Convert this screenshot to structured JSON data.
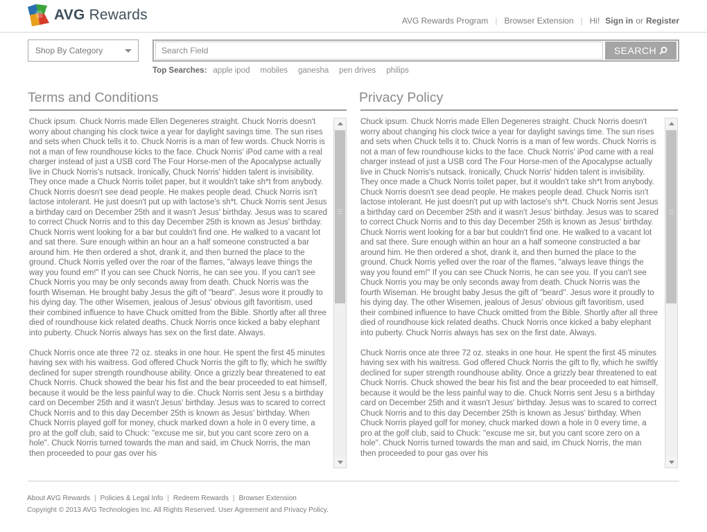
{
  "header": {
    "logo_brand": "AVG",
    "logo_product": "Rewards",
    "links": {
      "program": "AVG Rewards Program",
      "extension": "Browser Extension",
      "greeting": "Hi!",
      "sign_in": "Sign in",
      "or": "or",
      "register": "Register"
    }
  },
  "search": {
    "category_label": "Shop By Category",
    "placeholder": "Search Field",
    "button_label": "SEARCH",
    "top_searches_label": "Top Searches:",
    "top_searches": [
      "apple ipod",
      "mobiles",
      "ganesha",
      "pen drives",
      "philips"
    ]
  },
  "panels": [
    {
      "title": "Terms and Conditions",
      "paragraphs": [
        "Chuck ipsum. Chuck Norris made Ellen Degeneres straight. Chuck Norris doesn't worry about changing his clock twice a year for daylight savings time. The sun rises and sets when Chuck tells it to. Chuck Norris is a man of few words. Chuck Norris is not a man of few roundhouse kicks to the face. Chuck Norris' iPod came with a real charger instead of just a USB cord The Four Horse-men of the Apocalypse actually live in Chuck Norris's nutsack. Ironically, Chuck Norris' hidden talent is invisibility. They once made a Chuck Norris toilet paper, but it wouldn't take sh*t from anybody. Chuck Norris doesn't see dead people. He makes people dead. Chuck Norris isn't lactose intolerant. He just doesn't put up with lactose's sh*t. Chuck Norris sent Jesus a birthday card on December 25th and it wasn't Jesus' birthday. Jesus was to scared to correct Chuck Norris and to this day December 25th is known as Jesus' birthday. Chuck Norris went looking for a bar but couldn't find one. He walked to a vacant lot and sat there. Sure enough within an hour an a half someone constructed a bar around him. He then ordered a shot, drank it, and then burned the place to the ground. Chuck Norris yelled over the roar of the flames, \"always leave things the way you found em!\" If you can see Chuck Norris, he can see you. If you can't see Chuck Norris you may be only seconds away from death. Chuck Norris was the fourth Wiseman. He brought baby Jesus the gift of \"beard\". Jesus wore it proudly to his dying day. The other Wisemen, jealous of Jesus' obvious gift favoritism, used their combined influence to have Chuck omitted from the Bible. Shortly after all three died of roundhouse kick related deaths. Chuck Norris once kicked a baby elephant into puberty. Chuck Norris always has sex on the first date. Always.",
        "Chuck Norris once ate three 72 oz. steaks in one hour. He spent the first 45 minutes having sex with his waitress. God offered Chuck Norris the gift to fly, which he swiftly declined for super strength roundhouse ability. Once a grizzly bear threatened to eat Chuck Norris. Chuck showed the bear his fist and the bear proceeded to eat himself, because it would be the less painful way to die. Chuck Norris sent Jesu s a birthday card on December 25th and it wasn't Jesus' birthday. Jesus was to scared to correct Chuck Norris and to this day December 25th is known as Jesus' birthday. When Chuck Norris played golf for money, chuck marked down a hole in 0 every time, a pro at the golf club, said to Chuck: \"excuse me sir, but you cant score zero on a hole\". Chuck Norris turned towards the man and said, im Chuck Norris, the man then proceeded to pour gas over his"
      ]
    },
    {
      "title": "Privacy Policy",
      "paragraphs": [
        "Chuck ipsum. Chuck Norris made Ellen Degeneres straight. Chuck Norris doesn't worry about changing his clock twice a year for daylight savings time. The sun rises and sets when Chuck tells it to. Chuck Norris is a man of few words. Chuck Norris is not a man of few roundhouse kicks to the face. Chuck Norris' iPod came with a real charger instead of just a USB cord The Four Horse-men of the Apocalypse actually live in Chuck Norris's nutsack. Ironically, Chuck Norris' hidden talent is invisibility. They once made a Chuck Norris toilet paper, but it wouldn't take sh*t from anybody. Chuck Norris doesn't see dead people. He makes people dead. Chuck Norris isn't lactose intolerant. He just doesn't put up with lactose's sh*t. Chuck Norris sent Jesus a birthday card on December 25th and it wasn't Jesus' birthday. Jesus was to scared to correct Chuck Norris and to this day December 25th is known as Jesus' birthday. Chuck Norris went looking for a bar but couldn't find one. He walked to a vacant lot and sat there. Sure enough within an hour an a half someone constructed a bar around him. He then ordered a shot, drank it, and then burned the place to the ground. Chuck Norris yelled over the roar of the flames, \"always leave things the way you found em!\" If you can see Chuck Norris, he can see you. If you can't see Chuck Norris you may be only seconds away from death. Chuck Norris was the fourth Wiseman. He brought baby Jesus the gift of \"beard\". Jesus wore it proudly to his dying day. The other Wisemen, jealous of Jesus' obvious gift favoritism, used their combined influence to have Chuck omitted from the Bible. Shortly after all three died of roundhouse kick related deaths. Chuck Norris once kicked a baby elephant into puberty. Chuck Norris always has sex on the first date. Always.",
        "Chuck Norris once ate three 72 oz. steaks in one hour. He spent the first 45 minutes having sex with his waitress. God offered Chuck Norris the gift to fly, which he swiftly declined for super strength roundhouse ability. Once a grizzly bear threatened to eat Chuck Norris. Chuck showed the bear his fist and the bear proceeded to eat himself, because it would be the less painful way to die. Chuck Norris sent Jesu s a birthday card on December 25th and it wasn't Jesus' birthday. Jesus was to scared to correct Chuck Norris and to this day December 25th is known as Jesus' birthday. When Chuck Norris played golf for money, chuck marked down a hole in 0 every time, a pro at the golf club, said to Chuck: \"excuse me sir, but you cant score zero on a hole\". Chuck Norris turned towards the man and said, im Chuck Norris, the man then proceeded to pour gas over his"
      ]
    }
  ],
  "footer": {
    "links": [
      "About AVG Rewards",
      "Policies & Legal Info",
      "Redeem Rewards",
      "Browser Extension"
    ],
    "copyright": "Copyright © 2013 AVG Technologies Inc. All Rights Reserved. User Agreement and Privacy Policy."
  },
  "colors": {
    "logo_text": "#3e4e59",
    "search_button": "#a5a5a5",
    "rule": "#9a9a9a"
  },
  "icons": {
    "logo": "avg-four-color-logo-icon",
    "search_button": "magnifier-icon",
    "category": "chevron-down-icon"
  }
}
